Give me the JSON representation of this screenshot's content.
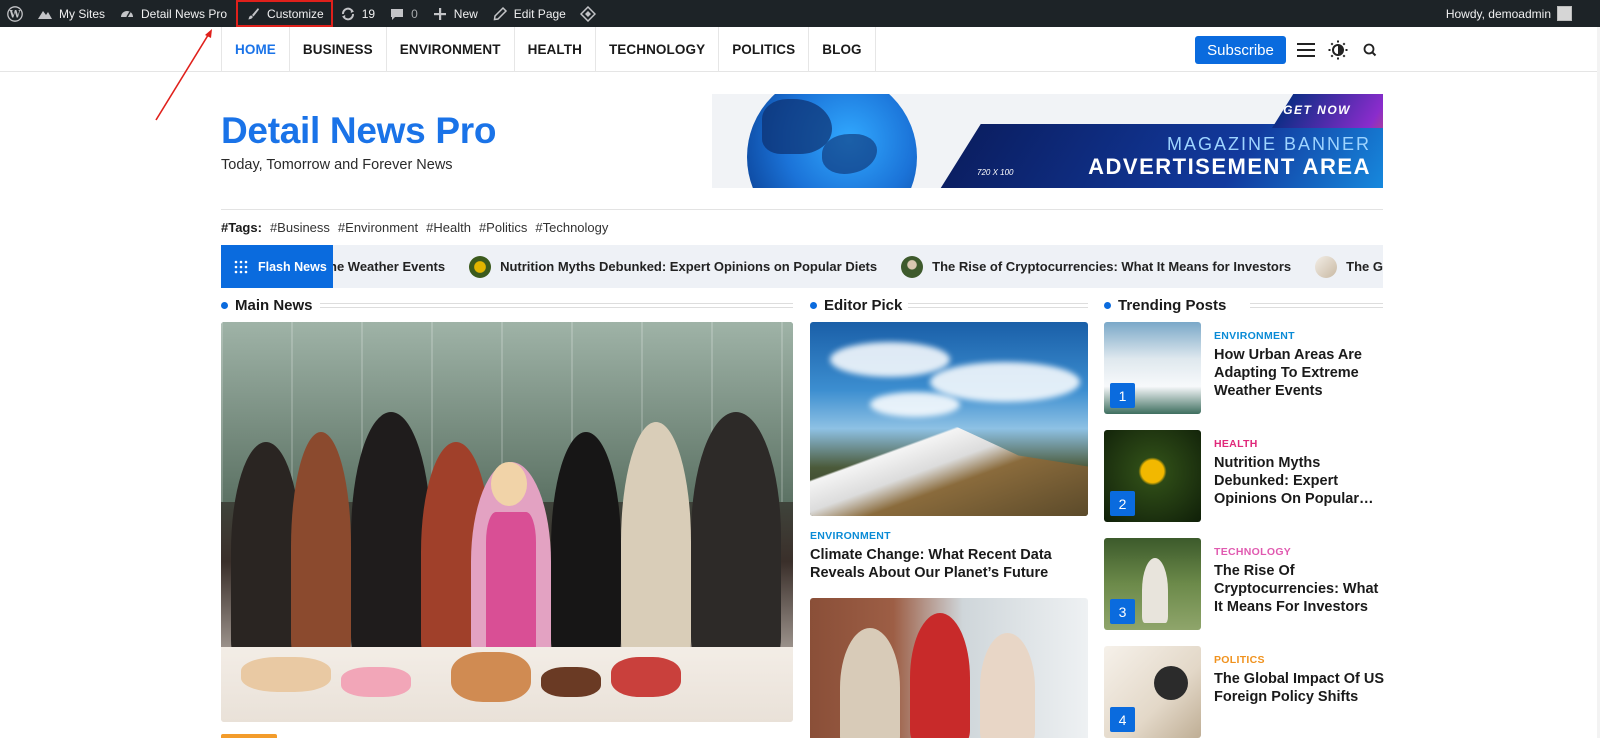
{
  "adminbar": {
    "wp_icon": "wordpress-icon",
    "my_sites": "My Sites",
    "site_name": "Detail News Pro",
    "customize": "Customize",
    "updates_count": "19",
    "comments_count": "0",
    "new": "New",
    "edit_page": "Edit Page",
    "howdy": "Howdy, demoadmin"
  },
  "nav": {
    "items": [
      "HOME",
      "BUSINESS",
      "ENVIRONMENT",
      "HEALTH",
      "TECHNOLOGY",
      "POLITICS",
      "BLOG"
    ],
    "subscribe": "Subscribe"
  },
  "header": {
    "title": "Detail News Pro",
    "tagline": "Today, Tomorrow and Forever News",
    "ad": {
      "get_now": "GET NOW",
      "line1": "MAGAZINE BANNER",
      "line2": "ADVERTISEMENT AREA",
      "size": "720 X 100"
    }
  },
  "tags": {
    "label": "#Tags:",
    "items": [
      "#Business",
      "#Environment",
      "#Health",
      "#Politics",
      "#Technology"
    ]
  },
  "flash": {
    "label": "Flash News",
    "items": [
      "ne Weather Events",
      "Nutrition Myths Debunked: Expert Opinions on Popular Diets",
      "The Rise of Cryptocurrencies: What It Means for Investors",
      "The Global Impa"
    ]
  },
  "sections": {
    "main_news": "Main News",
    "editor_pick": "Editor Pick",
    "trending": "Trending Posts"
  },
  "editor_pick": {
    "category": "ENVIRONMENT",
    "title": "Climate Change: What Recent Data Reveals About Our Planet’s Future"
  },
  "trending": [
    {
      "num": "1",
      "category": "ENVIRONMENT",
      "title": "How Urban Areas Are Adapting To Extreme Weather Events"
    },
    {
      "num": "2",
      "category": "HEALTH",
      "title": "Nutrition Myths Debunked: Expert Opinions On Popular…"
    },
    {
      "num": "3",
      "category": "TECHNOLOGY",
      "title": "The Rise Of Cryptocurrencies: What It Means For Investors"
    },
    {
      "num": "4",
      "category": "POLITICS",
      "title": "The Global Impact Of US Foreign Policy Shifts"
    }
  ],
  "colors": {
    "accent": "#1a73e8",
    "adminbar": "#1d2327",
    "environment": "#0a8bd6",
    "health": "#e0287a",
    "technology": "#e05ab0",
    "politics": "#f0921e"
  }
}
